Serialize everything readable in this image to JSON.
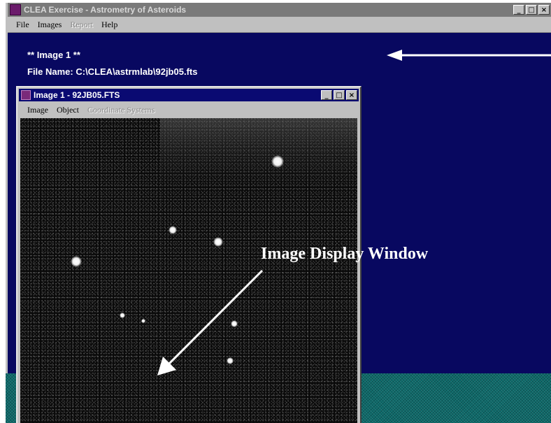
{
  "main_window": {
    "title": "CLEA Exercise - Astrometry of Asteroids",
    "controls": {
      "minimize": "_",
      "maximize": "□",
      "close": "×"
    },
    "menu": [
      {
        "label": "File",
        "enabled": true
      },
      {
        "label": "Images",
        "enabled": true
      },
      {
        "label": "Report",
        "enabled": false
      },
      {
        "label": "Help",
        "enabled": true
      }
    ],
    "client_heading": "** Image 1 **",
    "file_name_line": "File Name: C:\\CLEA\\astrmlab\\92jb05.fts"
  },
  "child_window": {
    "title": "Image 1 - 92JB05.FTS",
    "controls": {
      "minimize": "_",
      "maximize": "□",
      "close": "×"
    },
    "menu": [
      {
        "label": "Image",
        "enabled": true
      },
      {
        "label": "Object",
        "enabled": true
      },
      {
        "label": "Coordinate Systems",
        "enabled": false
      }
    ]
  },
  "annotation": {
    "label": "Image Display Window"
  },
  "colors": {
    "client_bg": "#080860",
    "child_title_bg": "#0a0a72",
    "desktop": "#0d6a6a"
  }
}
